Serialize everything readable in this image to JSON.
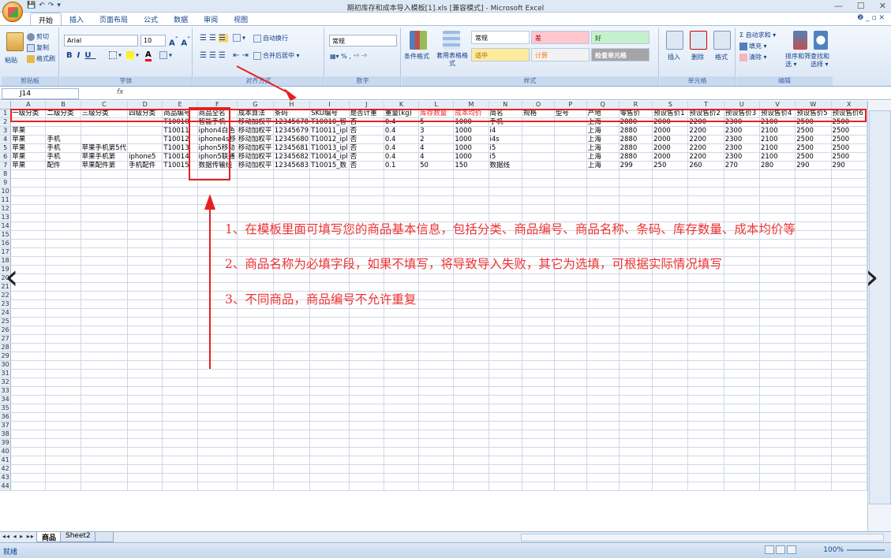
{
  "window": {
    "title": "期初库存和成本导入模板[1].xls  [兼容模式] - Microsoft Excel",
    "qat": [
      "💾",
      "↶",
      "↷",
      "▾"
    ],
    "controls": [
      "—",
      "☐",
      "✕"
    ]
  },
  "tabs": [
    "开始",
    "插入",
    "页面布局",
    "公式",
    "数据",
    "审阅",
    "视图"
  ],
  "active_tab": "开始",
  "help_controls": "❷ _ ▫ ✕",
  "ribbon": {
    "clipboard": {
      "label": "剪贴板",
      "paste": "粘贴",
      "cut": "剪切",
      "copy": "复制",
      "format_painter": "格式刷"
    },
    "font": {
      "label": "字体",
      "name": "Arial",
      "size": "10"
    },
    "alignment": {
      "label": "对齐方式",
      "wrap": "自动换行",
      "merge": "合并后居中 ▾"
    },
    "number": {
      "label": "数字",
      "format": "常规"
    },
    "styles": {
      "label": "样式",
      "conditional": "条件格式",
      "table": "套用表格格式",
      "boxes": [
        {
          "text": "常规",
          "bg": "#ffffff",
          "color": "#000000"
        },
        {
          "text": "差",
          "bg": "#ffc7ce",
          "color": "#9c0006"
        },
        {
          "text": "好",
          "bg": "#c6efce",
          "color": "#006100"
        },
        {
          "text": "适中",
          "bg": "#ffeb9c",
          "color": "#9c6500"
        },
        {
          "text": "计算",
          "bg": "#f2f2f2",
          "color": "#fa7d00"
        },
        {
          "text": "检查单元格",
          "bg": "#a5a5a5",
          "color": "#ffffff"
        }
      ]
    },
    "cells": {
      "label": "单元格",
      "insert": "插入",
      "delete": "删除",
      "format": "格式"
    },
    "editing": {
      "label": "编辑",
      "autosum": "Σ 自动求和 ▾",
      "fill": "填充 ▾",
      "clear": "清除 ▾",
      "sort": "排序和筛选 ▾",
      "find": "查找和选择 ▾"
    }
  },
  "namebox": "J14",
  "fx": "fx",
  "columns": [
    "A",
    "B",
    "C",
    "D",
    "E",
    "F",
    "G",
    "H",
    "I",
    "J",
    "K",
    "L",
    "M",
    "N",
    "O",
    "P",
    "Q",
    "R",
    "S",
    "T",
    "U",
    "V",
    "W",
    "X"
  ],
  "headers": [
    "一级分类",
    "二级分类",
    "三级分类",
    "四级分类",
    "商品编号",
    "商品全名",
    "成本算法",
    "条码",
    "SKU编号",
    "是否计重",
    "重量(kg)",
    "库存数量",
    "成本均价",
    "简名",
    "规格",
    "型号",
    "产地",
    "零售价",
    "预设售价1",
    "预设售价2",
    "预设售价3",
    "预设售价4",
    "预设售价5",
    "预设售价6"
  ],
  "red_header_cols": [
    11,
    12
  ],
  "rows": [
    [
      "",
      "",
      "",
      "",
      "T10010",
      "智能手机",
      "移动加权平",
      "12345678",
      "T10010_智",
      "否",
      "0.4",
      "5",
      "1000",
      "手机",
      "",
      "",
      "上海",
      "2880",
      "2000",
      "2200",
      "2300",
      "2100",
      "2500",
      "2500"
    ],
    [
      "苹果",
      "",
      "",
      "",
      "T10011",
      "iphon4白色",
      "移动加权平",
      "12345679",
      "T10011_ipl",
      "否",
      "0.4",
      "3",
      "1000",
      "i4",
      "",
      "",
      "上海",
      "2880",
      "2000",
      "2200",
      "2300",
      "2100",
      "2500",
      "2500"
    ],
    [
      "苹果",
      "手机",
      "",
      "",
      "T10012",
      "iphone4s移",
      "移动加权平",
      "12345680",
      "T10012_ipl",
      "否",
      "0.4",
      "2",
      "1000",
      "i4s",
      "",
      "",
      "上海",
      "2880",
      "2000",
      "2200",
      "2300",
      "2100",
      "2500",
      "2500"
    ],
    [
      "苹果",
      "手机",
      "苹果手机第5代",
      "",
      "T10013",
      "iphon5移动",
      "移动加权平",
      "12345681",
      "T10013_ipl",
      "否",
      "0.4",
      "4",
      "1000",
      "i5",
      "",
      "",
      "上海",
      "2880",
      "2000",
      "2200",
      "2300",
      "2100",
      "2500",
      "2500"
    ],
    [
      "苹果",
      "手机",
      "苹果手机第",
      "iphone5",
      "T10014",
      "iphon5联通",
      "移动加权平",
      "12345682",
      "T10014_ipl",
      "否",
      "0.4",
      "4",
      "1000",
      "i5",
      "",
      "",
      "上海",
      "2880",
      "2000",
      "2200",
      "2300",
      "2100",
      "2500",
      "2500"
    ],
    [
      "苹果",
      "配件",
      "苹果配件第",
      "手机配件",
      "T10015",
      "数据传输线",
      "移动加权平",
      "12345683",
      "T10015_数",
      "否",
      "0.1",
      "50",
      "150",
      "数据线",
      "",
      "",
      "上海",
      "299",
      "250",
      "260",
      "270",
      "280",
      "290",
      "290"
    ]
  ],
  "row_numbers_count": 44,
  "annotations": [
    "1、在模板里面可填写您的商品基本信息，包括分类、商品编号、商品名称、条码、库存数量、成本均价等",
    "2、商品名称为必填字段，如果不填写，将导致导入失败，其它为选填，可根据实际情况填写",
    "3、不同商品，商品编号不允许重复"
  ],
  "sheet_tabs": [
    "商品",
    "Sheet2"
  ],
  "sheet_nav": "◂◂ ◂ ▸ ▸▸",
  "status": {
    "ready": "就绪",
    "zoom": "100%"
  },
  "nav_arrows": {
    "left": "‹",
    "right": "›"
  }
}
